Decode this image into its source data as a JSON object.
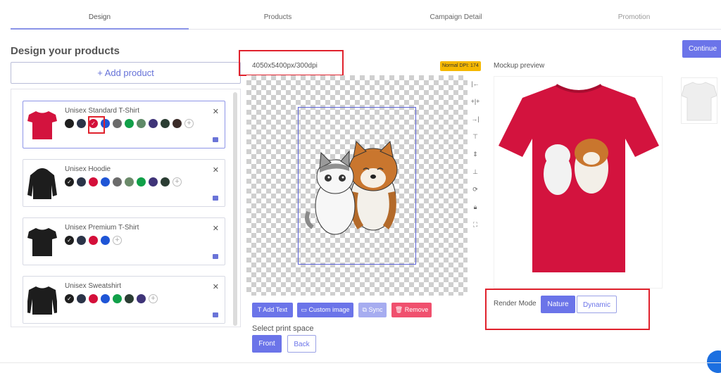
{
  "tabs": [
    "Design",
    "Products",
    "Campaign Detail",
    "Promotion"
  ],
  "page_title": "Design your products",
  "add_product": "+ Add product",
  "products": [
    {
      "name": "Unisex Standard T-Shirt",
      "colors": [
        "#1f1f1f",
        "#2b3448",
        "#d40f3a",
        "#1f55d6",
        "#6b6b6b",
        "#11a049",
        "#5f8a68",
        "#3f3478",
        "#2b3d33",
        "#3b2c29"
      ],
      "selected_index": 2
    },
    {
      "name": "Unisex Hoodie",
      "colors": [
        "#1f1f1f",
        "#2b3448",
        "#d40f3a",
        "#1f55d6",
        "#6b6b6b",
        "#6b8a6a",
        "#11a049",
        "#3f3478",
        "#2b3d33"
      ],
      "selected_index": 0
    },
    {
      "name": "Unisex Premium T-Shirt",
      "colors": [
        "#1f1f1f",
        "#2b3448",
        "#d40f3a",
        "#1f55d6"
      ],
      "selected_index": 0
    },
    {
      "name": "Unisex Sweatshirt",
      "colors": [
        "#1f1f1f",
        "#2b3448",
        "#d40f3a",
        "#1f55d6",
        "#11a049",
        "#2b3d33",
        "#3f3478"
      ],
      "selected_index": 0
    }
  ],
  "canvas": {
    "dimensions": "4050x5400px/300dpi",
    "dpi_badge": "Normal DPI: 174"
  },
  "tool_icons": [
    "align-left-icon",
    "align-center-h-icon",
    "align-right-icon",
    "align-top-icon",
    "align-center-v-icon",
    "align-bottom-icon",
    "rotate-icon",
    "lock-icon",
    "fullscreen-icon"
  ],
  "actions": {
    "add_text": "Add Text",
    "custom_image": "Custom image",
    "sync": "Sync",
    "remove": "Remove"
  },
  "print_space": {
    "label": "Select print space",
    "front": "Front",
    "back": "Back"
  },
  "mockup": {
    "label": "Mockup preview",
    "shirt_color": "#d3133e"
  },
  "render": {
    "label": "Render Mode",
    "nature": "Nature",
    "dynamic": "Dynamic"
  },
  "continue": "Continue",
  "colors": {
    "accent": "#6b74e9",
    "red_highlight": "#e0222d",
    "remove": "#f0506e"
  }
}
